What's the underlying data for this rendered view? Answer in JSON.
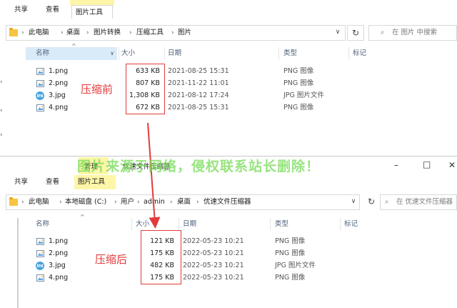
{
  "top_window": {
    "ribbon": {
      "tab_share": "共享",
      "tab_view": "查看",
      "tab_picture_tools": "图片工具"
    },
    "breadcrumb": [
      "此电脑",
      "桌面",
      "图片转换",
      "压缩工具",
      "图片"
    ],
    "search_placeholder": "在 图片 中搜索",
    "columns": {
      "name": "名称",
      "size": "大小",
      "date": "日期",
      "type": "类型",
      "tags": "标记"
    },
    "files": [
      {
        "name": "1.png",
        "size": "633 KB",
        "date": "2021-08-25 15:31",
        "type": "PNG 图像",
        "icon": "png-image-icon"
      },
      {
        "name": "2.png",
        "size": "807 KB",
        "date": "2021-11-22 11:01",
        "type": "PNG 图像",
        "icon": "png-image-icon"
      },
      {
        "name": "3.jpg",
        "size": "1,308 KB",
        "date": "2021-08-12 17:24",
        "type": "JPG 图片文件",
        "icon": "jpg-image-icon"
      },
      {
        "name": "4.png",
        "size": "672 KB",
        "date": "2021-08-25 15:31",
        "type": "PNG 图像",
        "icon": "png-image-icon"
      }
    ],
    "annotation": "压缩前"
  },
  "bottom_window": {
    "ribbon": {
      "tab_share": "共享",
      "tab_view": "查看",
      "tab_manage": "管理",
      "tab_picture_tools": "图片工具",
      "title": "优速文件压缩器"
    },
    "breadcrumb": [
      "此电脑",
      "本地磁盘 (C:)",
      "用户",
      "admin",
      "桌面",
      "优速文件压缩器"
    ],
    "search_placeholder": "在 优速文件压缩器",
    "columns": {
      "name": "名称",
      "size": "大小",
      "date": "日期",
      "type": "类型",
      "tags": "标记"
    },
    "files": [
      {
        "name": "1.png",
        "size": "121 KB",
        "date": "2022-05-23 10:21",
        "type": "PNG 图像",
        "icon": "png-image-icon"
      },
      {
        "name": "2.png",
        "size": "175 KB",
        "date": "2022-05-23 10:21",
        "type": "PNG 图像",
        "icon": "png-image-icon"
      },
      {
        "name": "3.jpg",
        "size": "482 KB",
        "date": "2022-05-23 10:21",
        "type": "JPG 图片文件",
        "icon": "jpg-image-icon"
      },
      {
        "name": "4.png",
        "size": "175 KB",
        "date": "2022-05-23 10:21",
        "type": "PNG 图像",
        "icon": "png-image-icon"
      }
    ],
    "annotation": "压缩后",
    "window_controls": {
      "minimize": "–",
      "maximize": "□",
      "close": "✕"
    }
  },
  "watermark": "图片来源于网络，侵权联系站长删除！",
  "colors": {
    "annotation_red": "#e23b3b",
    "context_tab_yellow": "#fdf6a8",
    "watermark_green": "#78dc5a",
    "header_text": "#4c607a"
  }
}
